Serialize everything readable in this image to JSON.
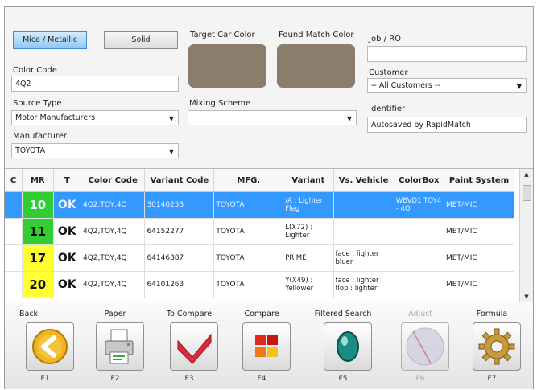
{
  "toggles": {
    "mica": "Mica / Metallic",
    "solid": "Solid"
  },
  "swatches": {
    "target_label": "Target Car Color",
    "found_label": "Found Match Color",
    "color": "#8b7d6c"
  },
  "fields": {
    "color_code_label": "Color Code",
    "color_code_value": "4Q2",
    "source_type_label": "Source Type",
    "source_type_value": "Motor Manufacturers",
    "mixing_scheme_label": "Mixing Scheme",
    "mixing_scheme_value": "",
    "manufacturer_label": "Manufacturer",
    "manufacturer_value": "TOYOTA",
    "job_label": "Job / RO",
    "job_value": "",
    "customer_label": "Customer",
    "customer_value": "-- All Customers --",
    "identifier_label": "Identifier",
    "identifier_value": "Autosaved by RapidMatch"
  },
  "grid": {
    "headers": [
      "C",
      "MR",
      "T",
      "Color Code",
      "Variant Code",
      "MFG.",
      "Variant",
      "Vs. Vehicle",
      "ColorBox",
      "Paint System"
    ],
    "rows": [
      {
        "c": "",
        "mr": "10",
        "mr_color": "#33cc33",
        "t": "OK",
        "color_code": "4Q2,TOY,4Q",
        "variant_code": "30140253",
        "mfg": "TOYOTA",
        "variant": "/A : Lighter Fleg",
        "vs_vehicle": "",
        "colorbox": "WBVD1 TOY4 - 4Q",
        "paint_system": "MET/MIC"
      },
      {
        "c": "",
        "mr": "11",
        "mr_color": "#33cc33",
        "t": "OK",
        "color_code": "4Q2,TOY,4Q",
        "variant_code": "64152277",
        "mfg": "TOYOTA",
        "variant": "L(X72) : Lighter",
        "vs_vehicle": "",
        "colorbox": "",
        "paint_system": "MET/MIC"
      },
      {
        "c": "",
        "mr": "17",
        "mr_color": "#ffff33",
        "t": "OK",
        "color_code": "4Q2,TOY,4Q",
        "variant_code": "64146387",
        "mfg": "TOYOTA",
        "variant": "PRIME",
        "vs_vehicle": "face : lighter bluer",
        "colorbox": "",
        "paint_system": "MET/MIC"
      },
      {
        "c": "",
        "mr": "20",
        "mr_color": "#ffff33",
        "t": "OK",
        "color_code": "4Q2,TOY,4Q",
        "variant_code": "64101263",
        "mfg": "TOYOTA",
        "variant": "Y(X49) : Yellower",
        "vs_vehicle": "face : lighter flop : lighter",
        "colorbox": "",
        "paint_system": "MET/MIC"
      }
    ]
  },
  "function_buttons": [
    {
      "label": "Back",
      "key": "F1",
      "icon": "back-arrow-icon"
    },
    {
      "label": "Paper",
      "key": "F2",
      "icon": "printer-icon"
    },
    {
      "label": "To Compare",
      "key": "F3",
      "icon": "checkmark-icon"
    },
    {
      "label": "Compare",
      "key": "F4",
      "icon": "color-tiles-icon"
    },
    {
      "label": "Filtered Search",
      "key": "F5",
      "icon": "lens-icon"
    },
    {
      "label": "Adjust",
      "key": "F6",
      "icon": "adjust-icon"
    },
    {
      "label": "Formula",
      "key": "F7",
      "icon": "gear-icon"
    }
  ]
}
